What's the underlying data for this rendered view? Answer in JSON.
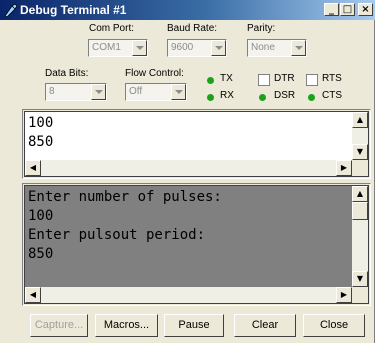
{
  "window": {
    "title": "Debug Terminal #1",
    "controls": {
      "minimize": "_",
      "maximize": "□",
      "close": "×"
    }
  },
  "settings": {
    "com_port": {
      "label": "Com Port:",
      "value": "COM1"
    },
    "baud_rate": {
      "label": "Baud Rate:",
      "value": "9600"
    },
    "parity": {
      "label": "Parity:",
      "value": "None"
    },
    "data_bits": {
      "label": "Data Bits:",
      "value": "8"
    },
    "flow_control": {
      "label": "Flow Control:",
      "value": "Off"
    }
  },
  "indicators": {
    "tx": "TX",
    "rx": "RX",
    "dtr": "DTR",
    "rts": "RTS",
    "dsr": "DSR",
    "cts": "CTS",
    "led_color": "#1aa31a"
  },
  "transmit_pane": {
    "lines": [
      "100",
      "850"
    ]
  },
  "receive_pane": {
    "lines": [
      "Enter number of pulses:",
      "100",
      "Enter pulsout period:",
      "850"
    ],
    "background": "#808080"
  },
  "buttons": {
    "capture": "Capture...",
    "macros": "Macros...",
    "pause": "Pause",
    "clear": "Clear",
    "close": "Close"
  },
  "icons": {
    "title": "debug-terminal-icon",
    "arrow_up": "scroll-up-arrow",
    "arrow_down": "scroll-down-arrow",
    "arrow_left": "scroll-left-arrow",
    "arrow_right": "scroll-right-arrow"
  }
}
